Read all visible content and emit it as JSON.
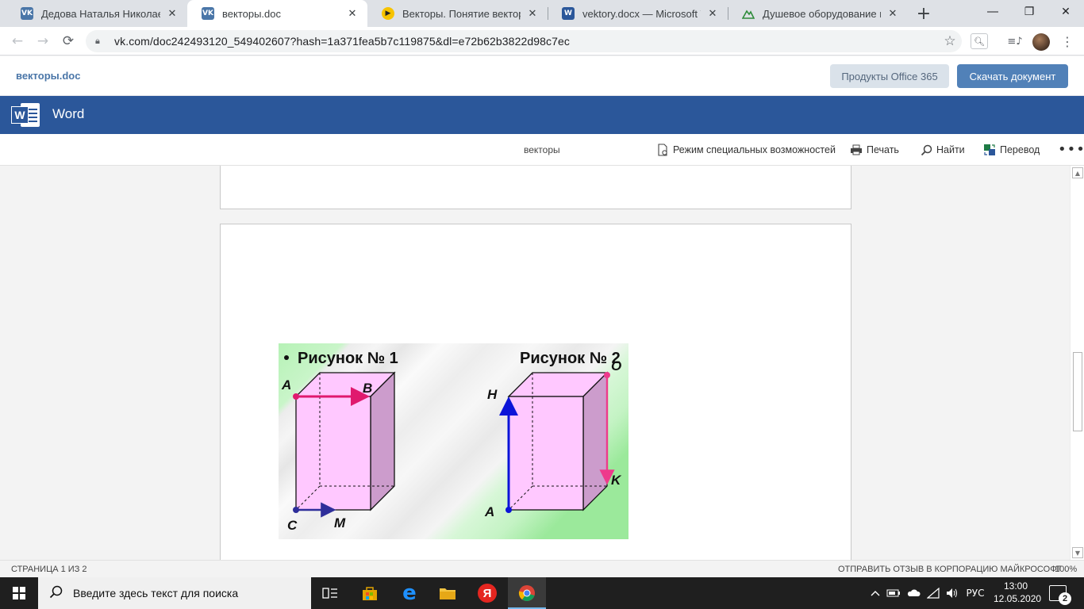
{
  "browser": {
    "tabs": [
      {
        "title": "Дедова Наталья Николаевна",
        "favicon": "vk-icon"
      },
      {
        "title": "векторы.doc",
        "favicon": "vk-icon"
      },
      {
        "title": "Векторы. Понятие вектора. Ра",
        "favicon": "play-icon"
      },
      {
        "title": "vektory.docx — Microsoft Wor",
        "favicon": "word-icon"
      },
      {
        "title": "Душевое оборудование в Тю",
        "favicon": "green-mountain-icon"
      }
    ],
    "active_tab": 1,
    "url": "vk.com/doc242493120_549402607?hash=1a371fea5b7c119875&dl=e72b62b3822d98c7ec"
  },
  "vk": {
    "doc_title": "векторы.doc",
    "office_button": "Продукты Office 365",
    "download_button": "Скачать документ"
  },
  "word": {
    "app_name": "Word",
    "doc_name": "векторы",
    "commands": {
      "accessibility": "Режим специальных возможностей",
      "print": "Печать",
      "find": "Найти",
      "translate": "Перевод"
    }
  },
  "figure": {
    "title1": "Рисунок № 1",
    "title2": "Рисунок № 2",
    "fig1_labels": {
      "a": "A",
      "b": "B",
      "c": "C",
      "m": "M"
    },
    "fig2_labels": {
      "h": "H",
      "o": "O",
      "k": "K",
      "a": "A"
    },
    "colors": {
      "box_fill": "#ffc8ff",
      "vector_ab": "#e0196e",
      "vector_cm": "#2e2e9a",
      "vector_ah": "#0b14d8",
      "vector_ok": "#ee3a8c"
    }
  },
  "status": {
    "page": "СТРАНИЦА 1 ИЗ 2",
    "feedback": "ОТПРАВИТЬ ОТЗЫВ В КОРПОРАЦИЮ МАЙКРОСОФТ",
    "zoom": "100%"
  },
  "taskbar": {
    "search_placeholder": "Введите здесь текст для поиска",
    "language": "РУС",
    "time": "13:00",
    "date": "12.05.2020",
    "notifications": "2"
  }
}
